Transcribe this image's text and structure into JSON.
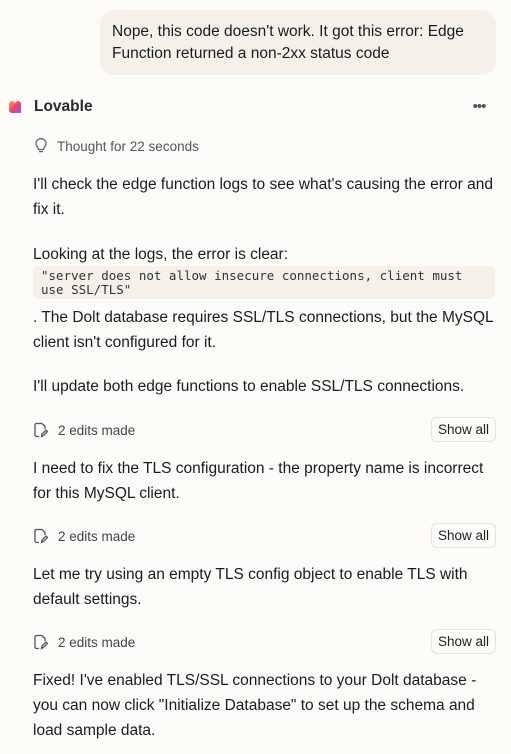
{
  "user_message": "Nope, this code doesn't work. It got this error: Edge Function returned a non-2xx status code",
  "assistant": {
    "name": "Lovable",
    "brand_color": "#e8456b",
    "more_icon": "more-horizontal-icon",
    "thought_label": "Thought for 22 seconds",
    "thought_icon": "lightbulb-icon"
  },
  "messages": {
    "intro": "I'll check the edge function logs to see what's causing the error and fix it.",
    "logs_lead": "Looking at the logs, the error is clear:",
    "error_code": "\"server does not allow insecure connections, client must use SSL/TLS\"",
    "ssl_explanation": ". The Dolt database requires SSL/TLS connections, but the MySQL client isn't configured for it.",
    "update_plan": "I'll update both edge functions to enable SSL/TLS connections.",
    "tls_property": "I need to fix the TLS configuration - the property name is incorrect for this MySQL client.",
    "empty_tls": "Let me try using an empty TLS config object to enable TLS with default settings.",
    "fixed": "Fixed! I've enabled TLS/SSL connections to your Dolt database - you can now click \"Initialize Database\" to set up the schema and load sample data."
  },
  "edits": [
    {
      "label": "2 edits made",
      "button": "Show all",
      "icon": "edit-file-icon"
    },
    {
      "label": "2 edits made",
      "button": "Show all",
      "icon": "edit-file-icon"
    },
    {
      "label": "2 edits made",
      "button": "Show all",
      "icon": "edit-file-icon"
    }
  ]
}
